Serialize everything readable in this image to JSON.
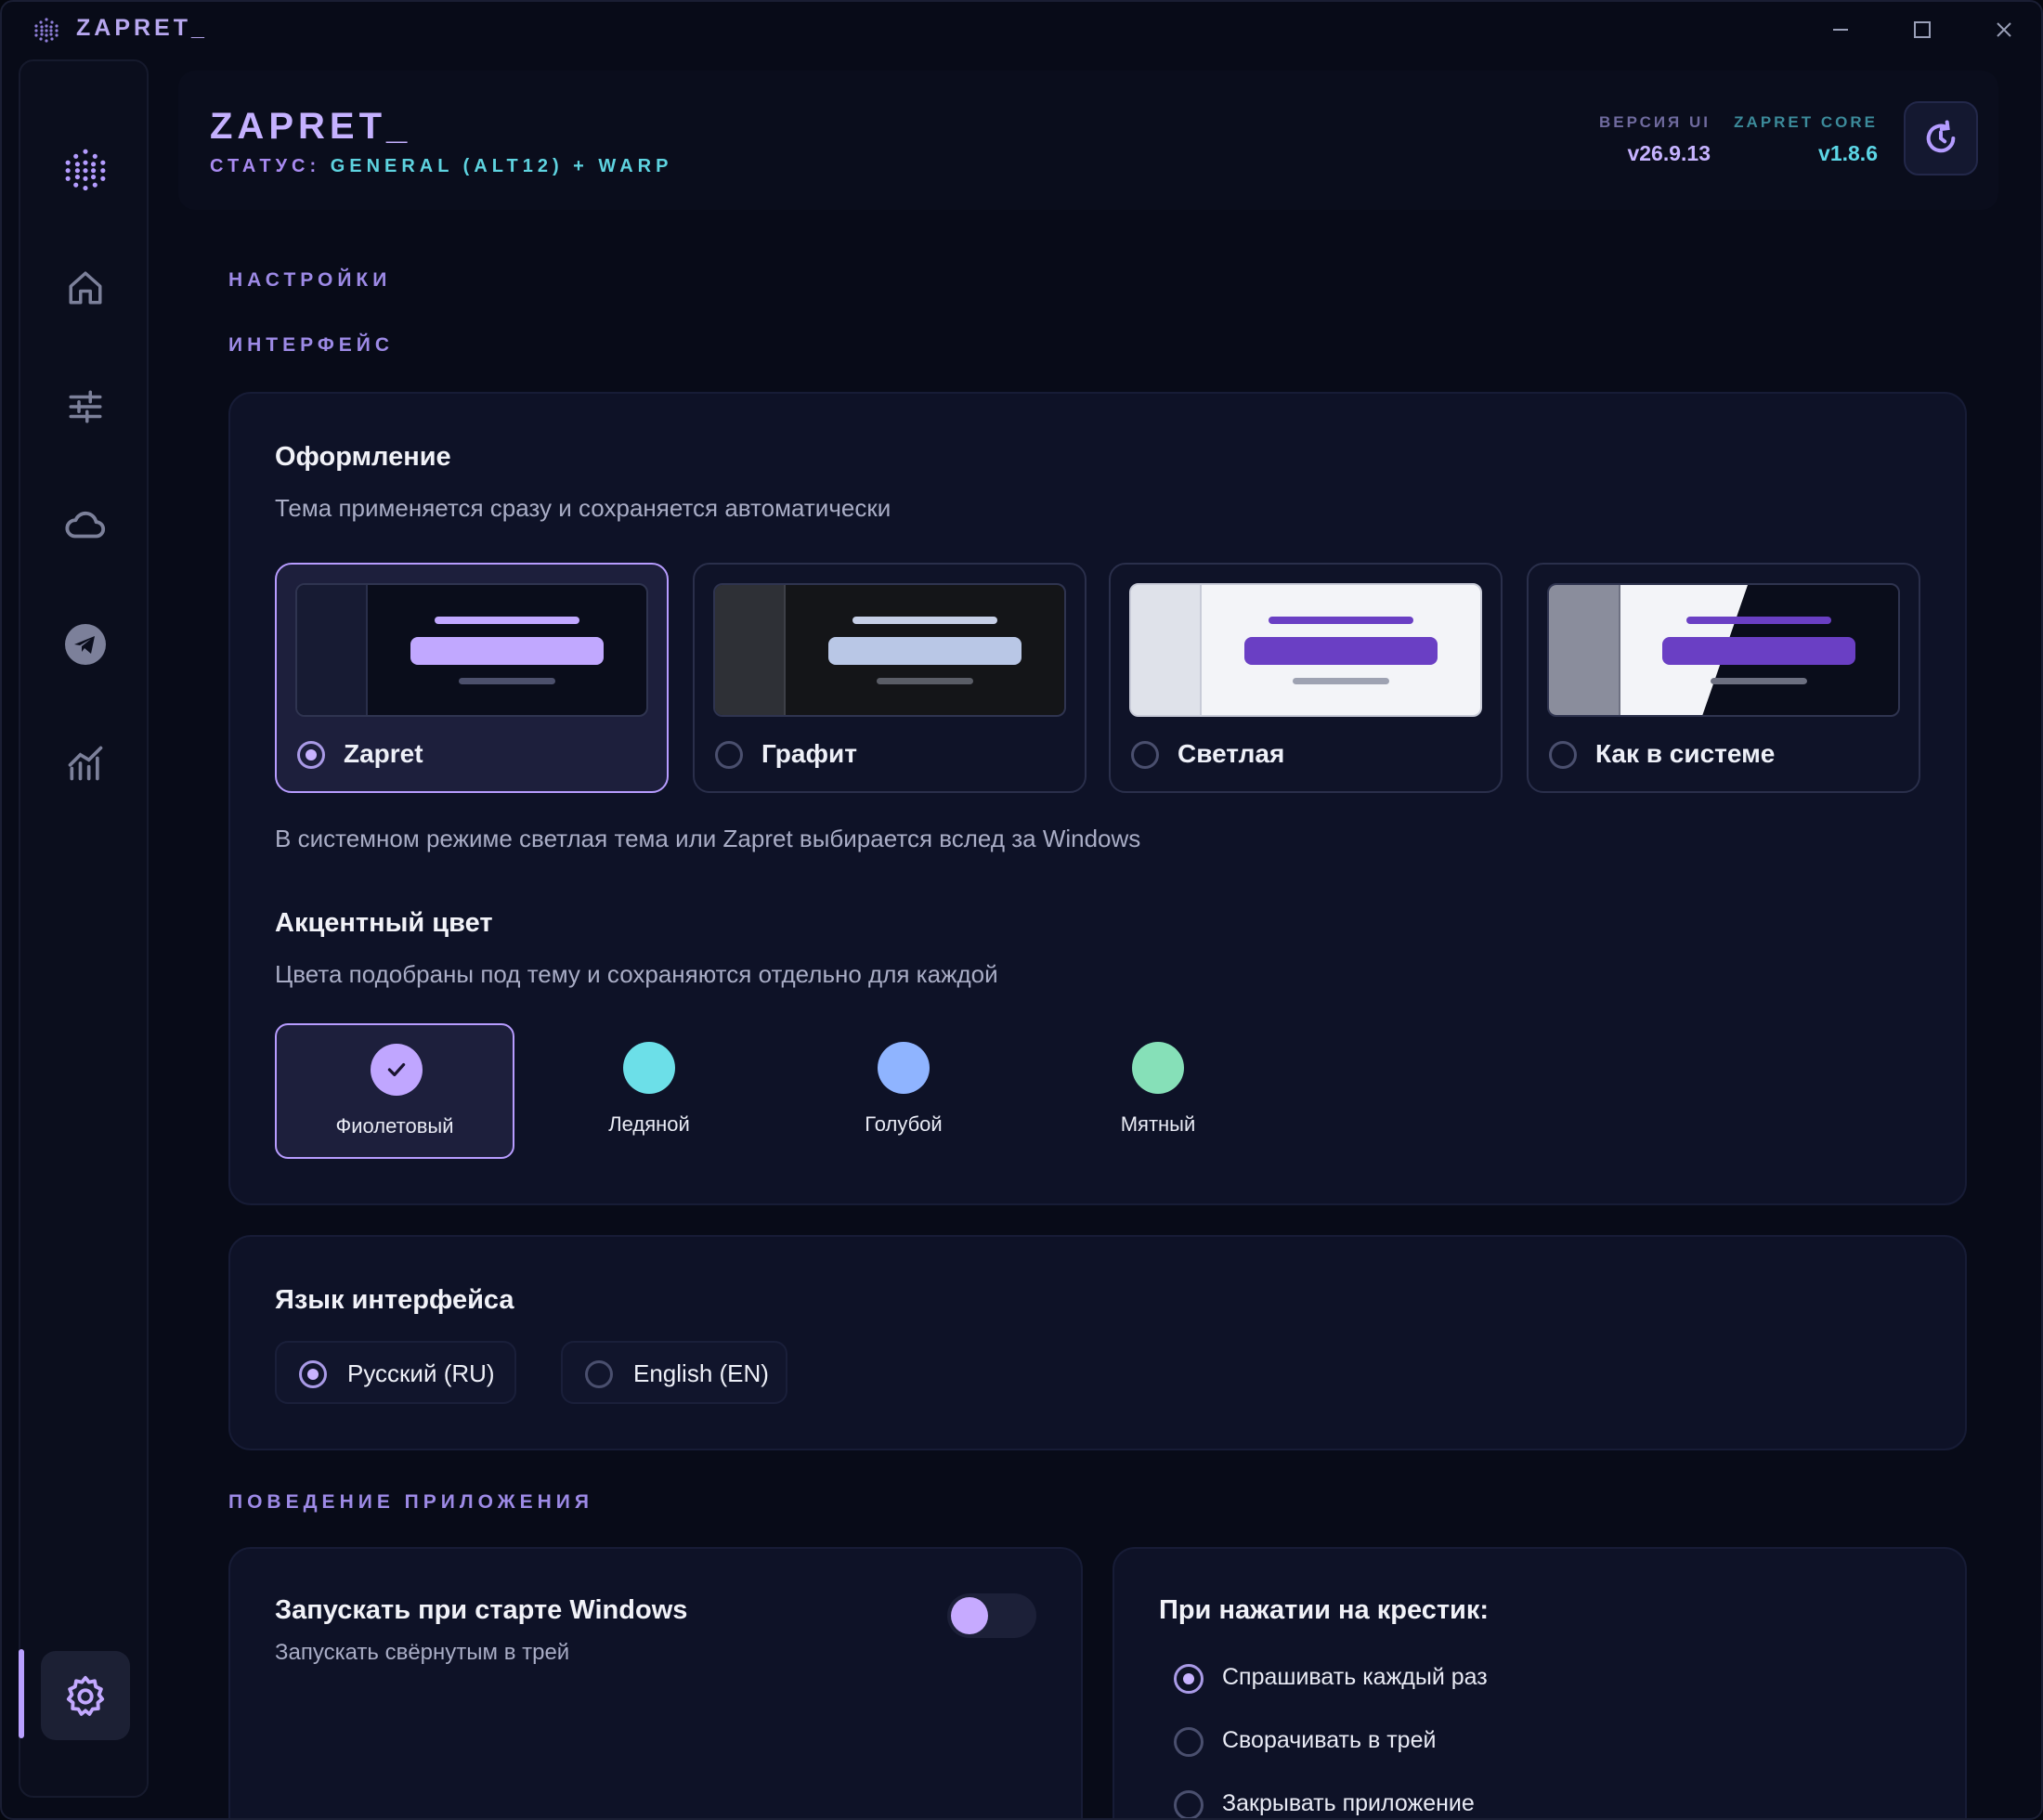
{
  "window": {
    "title": "ZAPRET_"
  },
  "header": {
    "title": "ZAPRET_",
    "status_label": "СТАТУС:",
    "status_value": "GENERAL (ALT12) + WARP",
    "ui_version_label": "ВЕРСИЯ UI",
    "ui_version": "v26.9.13",
    "core_version_label": "ZAPRET CORE",
    "core_version": "v1.8.6"
  },
  "sidebar": {
    "items": [
      {
        "icon": "dots-logo-icon"
      },
      {
        "icon": "home-icon"
      },
      {
        "icon": "sliders-icon"
      },
      {
        "icon": "cloud-icon"
      },
      {
        "icon": "telegram-icon"
      },
      {
        "icon": "chart-icon"
      },
      {
        "icon": "gear-icon",
        "active": true
      }
    ]
  },
  "page": {
    "section_settings": "НАСТРОЙКИ",
    "section_interface": "ИНТЕРФЕЙС",
    "section_behavior": "ПОВЕДЕНИЕ ПРИЛОЖЕНИЯ"
  },
  "appearance": {
    "title": "Оформление",
    "subtitle": "Тема применяется сразу и сохраняется автоматически",
    "themes": [
      {
        "label": "Zapret",
        "selected": true
      },
      {
        "label": "Графит",
        "selected": false
      },
      {
        "label": "Светлая",
        "selected": false
      },
      {
        "label": "Как в системе",
        "selected": false
      }
    ],
    "note": "В системном режиме светлая тема или Zapret выбирается вслед за Windows"
  },
  "accent": {
    "title": "Акцентный цвет",
    "subtitle": "Цвета подобраны под тему и сохраняются отдельно для каждой",
    "options": [
      {
        "label": "Фиолетовый",
        "color": "#c0a6ff",
        "selected": true
      },
      {
        "label": "Ледяной",
        "color": "#6cdfe8",
        "selected": false
      },
      {
        "label": "Голубой",
        "color": "#8fb4ff",
        "selected": false
      },
      {
        "label": "Мятный",
        "color": "#86e0b8",
        "selected": false
      }
    ]
  },
  "language": {
    "title": "Язык интерфейса",
    "options": [
      {
        "label": "Русский (RU)",
        "selected": true
      },
      {
        "label": "English (EN)",
        "selected": false
      }
    ]
  },
  "autostart": {
    "title": "Запускать при старте Windows",
    "subtitle": "Запускать свёрнутым в трей",
    "enabled": false
  },
  "close_action": {
    "title": "При нажатии на крестик:",
    "options": [
      {
        "label": "Спрашивать каждый раз",
        "selected": true
      },
      {
        "label": "Сворачивать в трей",
        "selected": false
      },
      {
        "label": "Закрывать приложение",
        "selected": false
      }
    ]
  }
}
